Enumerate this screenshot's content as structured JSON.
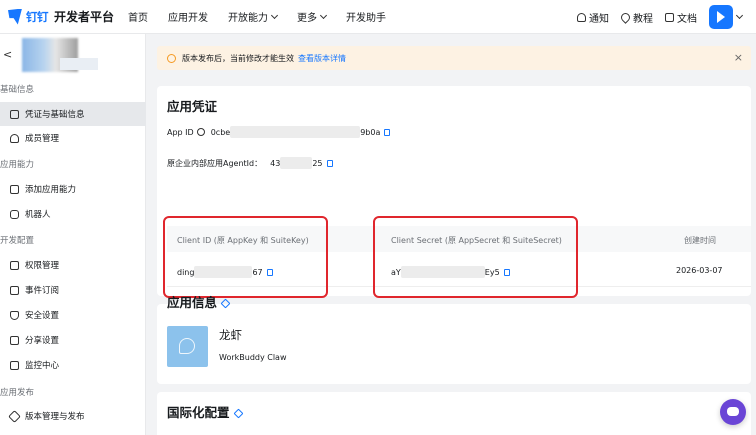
{
  "topbar": {
    "logo_text": "钉钉",
    "brand": "开发者平台",
    "nav": [
      "首页",
      "应用开发",
      "开放能力",
      "更多",
      "开发助手"
    ],
    "tools": [
      "通知",
      "教程",
      "文档"
    ]
  },
  "sidebar": {
    "back": "<",
    "groups": [
      {
        "title": "基础信息",
        "items": [
          {
            "label": "凭证与基础信息",
            "icon": "credential-icon",
            "active": true
          },
          {
            "label": "成员管理",
            "icon": "member-icon"
          }
        ]
      },
      {
        "title": "应用能力",
        "items": [
          {
            "label": "添加应用能力",
            "icon": "add-ability-icon"
          },
          {
            "label": "机器人",
            "icon": "robot-icon"
          }
        ]
      },
      {
        "title": "开发配置",
        "items": [
          {
            "label": "权限管理",
            "icon": "lock-icon"
          },
          {
            "label": "事件订阅",
            "icon": "event-icon"
          },
          {
            "label": "安全设置",
            "icon": "shield-icon"
          },
          {
            "label": "分享设置",
            "icon": "share-icon"
          },
          {
            "label": "监控中心",
            "icon": "monitor-icon"
          }
        ]
      },
      {
        "title": "应用发布",
        "items": [
          {
            "label": "版本管理与发布",
            "icon": "version-icon"
          }
        ]
      }
    ]
  },
  "notice": {
    "text": "版本发布后，当前修改才能生效",
    "link": "查看版本详情",
    "close": "×"
  },
  "credentials": {
    "title": "应用凭证",
    "app_id_label": "App ID",
    "app_id_start": "0cbe",
    "app_id_end": "9b0a",
    "agent_id_label": "原企业内部应用AgentId：",
    "agent_id_start": "43",
    "agent_id_end": "25",
    "col_client_id": "Client ID (原 AppKey 和 SuiteKey)",
    "col_client_secret": "Client Secret (原 AppSecret 和 SuiteSecret)",
    "col_created": "创建时间",
    "client_id_start": "ding",
    "client_id_end": "67",
    "client_secret_start": "aY",
    "client_secret_end": "Ey5",
    "created": "2026-03-07"
  },
  "app_info": {
    "title": "应用信息",
    "name": "龙虾",
    "subtitle": "WorkBuddy Claw"
  },
  "i18n": {
    "title": "国际化配置"
  }
}
